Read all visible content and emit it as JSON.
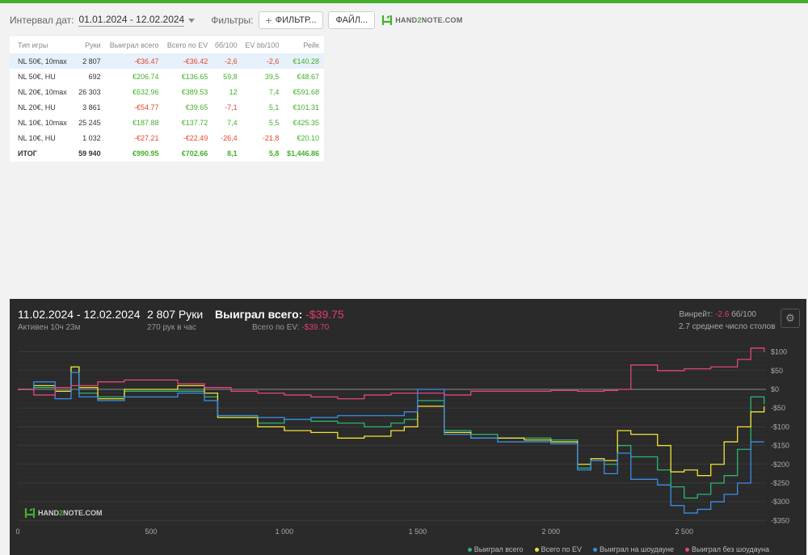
{
  "filterbar": {
    "date_label": "Интервал дат:",
    "date_value": "01.01.2024 - 12.02.2024",
    "filters_label": "Фильтры:",
    "filter_button": "ФИЛЬТР...",
    "file_button": "ФАЙЛ...",
    "logo_text_1": "HAND",
    "logo_text_2": "2",
    "logo_text_3": "NOTE.COM"
  },
  "stats": {
    "headers": [
      "Тип игры",
      "Руки",
      "Выиграл всего",
      "Всего по EV",
      "бб/100",
      "EV bb/100",
      "Рейк"
    ],
    "rows": [
      {
        "type": "NL 50€, 10max",
        "hands": "2 807",
        "won": "-€36.47",
        "ev": "-€36.42",
        "bb": "-2,6",
        "evbb": "-2,6",
        "rake": "€140.28"
      },
      {
        "type": "NL 50€, HU",
        "hands": "692",
        "won": "€206.74",
        "ev": "€136.65",
        "bb": "59,8",
        "evbb": "39,5",
        "rake": "€48.67"
      },
      {
        "type": "NL 20€, 10max",
        "hands": "26 303",
        "won": "€632.96",
        "ev": "€389.53",
        "bb": "12",
        "evbb": "7,4",
        "rake": "€591.68"
      },
      {
        "type": "NL 20€, HU",
        "hands": "3 861",
        "won": "-€54.77",
        "ev": "€39.65",
        "bb": "-7,1",
        "evbb": "5,1",
        "rake": "€101.31"
      },
      {
        "type": "NL 10€, 10max",
        "hands": "25 245",
        "won": "€187.88",
        "ev": "€137.72",
        "bb": "7,4",
        "evbb": "5,5",
        "rake": "€425.35"
      },
      {
        "type": "NL 10€, HU",
        "hands": "1 032",
        "won": "-€27.21",
        "ev": "-€22.49",
        "bb": "-26,4",
        "evbb": "-21,8",
        "rake": "€20.10"
      }
    ],
    "total": {
      "type": "ИТОГ",
      "hands": "59 940",
      "won": "€990.95",
      "ev": "€702.66",
      "bb": "8,1",
      "evbb": "5,8",
      "rake": "$1,446.86"
    }
  },
  "panel": {
    "dates": "11.02.2024 - 12.02.2024",
    "active": "Активен 10ч 23м",
    "hands": "2 807 Руки",
    "hands_rate": "270 рук в час",
    "won_label": "Выиграл всего:",
    "won_value": "-$39.75",
    "ev_label": "Всего по EV:",
    "ev_value": "-$39.70",
    "winrate_label": "Винрейт:",
    "winrate_value": "-2.6",
    "winrate_unit": "бб/100",
    "tables": "2.7 среднее число столов",
    "gear_icon": "gear-icon",
    "logo_text_1": "HAND",
    "logo_text_2": "2",
    "logo_text_3": "NOTE.COM"
  },
  "chart_data": {
    "type": "line",
    "x_ticks": [
      0,
      500,
      1000,
      1500,
      2000,
      2500
    ],
    "x_tick_labels": [
      "0",
      "500",
      "1 000",
      "1 500",
      "2 000",
      "2 500"
    ],
    "y_ticks": [
      100,
      50,
      0,
      -50,
      -100,
      -150,
      -200,
      -250,
      -300,
      -350
    ],
    "y_tick_labels": [
      "$100",
      "$50",
      "$0",
      "-$50",
      "-$100",
      "-$150",
      "-$200",
      "-$250",
      "-$300",
      "-$350"
    ],
    "xlim": [
      0,
      2807
    ],
    "ylim": [
      -360,
      125
    ],
    "grid": true,
    "legend_position": "bottom-right",
    "series": [
      {
        "name": "Выиграл всего",
        "color": "#2bb673",
        "x": [
          0,
          60,
          140,
          200,
          230,
          300,
          400,
          600,
          700,
          750,
          900,
          1000,
          1100,
          1200,
          1300,
          1400,
          1450,
          1500,
          1600,
          1700,
          1800,
          1900,
          2000,
          2100,
          2150,
          2200,
          2250,
          2300,
          2400,
          2450,
          2500,
          2550,
          2600,
          2650,
          2700,
          2750,
          2800
        ],
        "y": [
          0,
          5,
          -5,
          60,
          -10,
          -20,
          -5,
          -5,
          -20,
          -70,
          -90,
          -80,
          -85,
          -90,
          -100,
          -90,
          -80,
          -30,
          -110,
          -120,
          -130,
          -130,
          -135,
          -210,
          -190,
          -200,
          -150,
          -180,
          -215,
          -260,
          -290,
          -280,
          -250,
          -230,
          -160,
          -20,
          -40
        ]
      },
      {
        "name": "Всего по EV",
        "color": "#f1e23a",
        "x": [
          0,
          60,
          140,
          200,
          230,
          300,
          400,
          600,
          700,
          750,
          900,
          1000,
          1100,
          1200,
          1300,
          1400,
          1450,
          1500,
          1600,
          1700,
          1800,
          1900,
          2000,
          2100,
          2150,
          2200,
          2250,
          2300,
          2400,
          2450,
          2500,
          2550,
          2600,
          2650,
          2700,
          2750,
          2800
        ],
        "y": [
          0,
          10,
          -5,
          60,
          5,
          -25,
          0,
          10,
          -10,
          -75,
          -100,
          -110,
          -115,
          -130,
          -125,
          -110,
          -100,
          -45,
          -115,
          -130,
          -130,
          -135,
          -140,
          -200,
          -185,
          -190,
          -110,
          -120,
          -150,
          -220,
          -215,
          -230,
          -200,
          -140,
          -100,
          -60,
          -45
        ]
      },
      {
        "name": "Выиграл на шоудауне",
        "color": "#3a8de8",
        "x": [
          0,
          60,
          140,
          200,
          230,
          300,
          400,
          600,
          700,
          750,
          900,
          1000,
          1100,
          1200,
          1300,
          1400,
          1450,
          1500,
          1600,
          1700,
          1800,
          1900,
          2000,
          2100,
          2150,
          2200,
          2250,
          2300,
          2400,
          2450,
          2500,
          2550,
          2600,
          2650,
          2700,
          2750,
          2800
        ],
        "y": [
          0,
          20,
          -25,
          45,
          -20,
          -30,
          -20,
          -10,
          -30,
          -70,
          -75,
          -80,
          -75,
          -70,
          -70,
          -70,
          -60,
          0,
          -120,
          -130,
          -140,
          -140,
          -145,
          -215,
          -190,
          -225,
          -170,
          -240,
          -255,
          -310,
          -330,
          -320,
          -300,
          -280,
          -250,
          -140,
          -140
        ]
      },
      {
        "name": "Выиграл без шоудауна",
        "color": "#e2467f",
        "x": [
          0,
          60,
          140,
          200,
          300,
          400,
          600,
          700,
          800,
          900,
          1000,
          1100,
          1200,
          1300,
          1400,
          1500,
          1600,
          1700,
          1800,
          1900,
          2000,
          2100,
          2200,
          2250,
          2300,
          2400,
          2500,
          2600,
          2700,
          2750,
          2800
        ],
        "y": [
          0,
          -15,
          5,
          10,
          20,
          25,
          15,
          5,
          -5,
          -10,
          -15,
          -20,
          -25,
          -15,
          -10,
          -10,
          -15,
          -5,
          -5,
          -5,
          -3,
          -5,
          -3,
          0,
          65,
          50,
          55,
          60,
          80,
          110,
          100
        ]
      }
    ]
  }
}
